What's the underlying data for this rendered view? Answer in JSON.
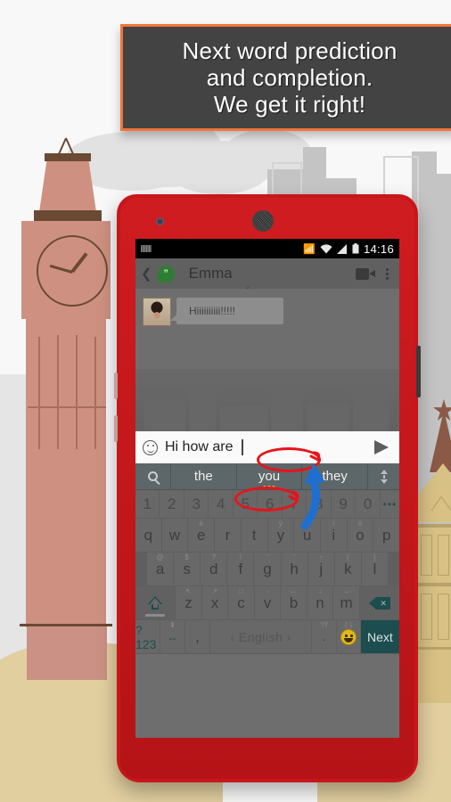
{
  "banner": {
    "lines": [
      "Next word prediction",
      "and completion.",
      "We get it right!"
    ],
    "bg_color": "#434343",
    "border_color": "#f2743a",
    "text_color": "#ffffff"
  },
  "phone": {
    "body_color": "#c8161b",
    "camera": "front-camera",
    "speaker": "earpiece-speaker"
  },
  "statusbar": {
    "keyboard_icon": "keyboard-notification-icon",
    "bluetooth_icon": "bluetooth-icon",
    "wifi_icon": "wifi-icon",
    "signal_icon": "cellular-signal-icon",
    "battery_icon": "battery-icon",
    "clock": "14:16"
  },
  "appbar": {
    "back_icon": "back-chevron-icon",
    "app_icon": "hangouts-icon",
    "app_icon_glyph": "”",
    "contact_name": "Emma",
    "video_call_icon": "video-camera-icon",
    "overflow_icon": "overflow-menu-icon"
  },
  "chat": {
    "avatar": "contact-avatar",
    "messages": [
      {
        "sender": "Emma",
        "text": "Hiiiiiiiiii!!!!!"
      }
    ]
  },
  "input": {
    "emoji_icon": "emoji-smiley-icon",
    "value": "Hi how are",
    "send_icon": "send-arrow-icon"
  },
  "predictions": {
    "search_icon": "search-magnifier-icon",
    "items": [
      {
        "label": "the",
        "selected": false
      },
      {
        "label": "you",
        "selected": true
      },
      {
        "label": "they",
        "selected": false
      }
    ],
    "expand_icon": "expand-collapse-arrows-icon"
  },
  "keyboard": {
    "row_numbers": [
      {
        "key": "1",
        "hint": ""
      },
      {
        "key": "2",
        "hint": ""
      },
      {
        "key": "3",
        "hint": ""
      },
      {
        "key": "4",
        "hint": ""
      },
      {
        "key": "5",
        "hint": ""
      },
      {
        "key": "6",
        "hint": ""
      },
      {
        "key": "7",
        "hint": ""
      },
      {
        "key": "8",
        "hint": ""
      },
      {
        "key": "9",
        "hint": ""
      },
      {
        "key": "0",
        "hint": ""
      },
      {
        "key": "•••",
        "hint": ""
      }
    ],
    "row_top": [
      {
        "key": "q",
        "hint": ""
      },
      {
        "key": "w",
        "hint": ""
      },
      {
        "key": "e",
        "hint": "è"
      },
      {
        "key": "r",
        "hint": ""
      },
      {
        "key": "t",
        "hint": ""
      },
      {
        "key": "y",
        "hint": "ý"
      },
      {
        "key": "u",
        "hint": "ú"
      },
      {
        "key": "i",
        "hint": "í"
      },
      {
        "key": "o",
        "hint": "ö"
      },
      {
        "key": "p",
        "hint": ""
      }
    ],
    "row_home": [
      {
        "key": "a",
        "hint": "@"
      },
      {
        "key": "s",
        "hint": "$"
      },
      {
        "key": "d",
        "hint": "?"
      },
      {
        "key": "f",
        "hint": "!"
      },
      {
        "key": "g",
        "hint": "‘"
      },
      {
        "key": "h",
        "hint": "’"
      },
      {
        "key": "j",
        "hint": "↑"
      },
      {
        "key": "k",
        "hint": "("
      },
      {
        "key": "l",
        "hint": ")"
      }
    ],
    "row_bottom": [
      {
        "key": "z",
        "hint": "↖"
      },
      {
        "key": "x",
        "hint": "↗"
      },
      {
        "key": "c",
        "hint": "□"
      },
      {
        "key": "v",
        "hint": "-"
      },
      {
        "key": "b",
        "hint": "←"
      },
      {
        "key": "n",
        "hint": "↓"
      },
      {
        "key": "m",
        "hint": "→"
      }
    ],
    "shift_key": "shift-key",
    "delete_key": "backspace-key",
    "row_function": {
      "symbols_label": "?123",
      "swipe_label": "↔",
      "swipe_hint": "⬇",
      "comma_label": ",",
      "space_label": "‹ English ›",
      "period_label": ".",
      "period_hint": "'!?",
      "emoji_label": "emoji-key",
      "emoji_hint": "(·)",
      "next_label": "Next"
    },
    "accent_color": "#1d4d4f"
  },
  "annotations": {
    "ellipse_input": "red-ellipse-highlight-input",
    "ellipse_prediction": "red-ellipse-highlight-you",
    "arrow": "blue-curved-arrow",
    "ellipse_color": "#e8131a",
    "arrow_color": "#1f6fd0"
  },
  "background": {
    "scene": "london-skyline-illustration",
    "landmark_left": "big-ben-clock-tower",
    "landmark_right": "westminster-building",
    "sky_color": "#f8f8f8",
    "cloud_color": "#e2e2e2",
    "ground_color": "#e2cfa0",
    "tower_color": "#ce9181",
    "building_color": "#d8c184"
  }
}
